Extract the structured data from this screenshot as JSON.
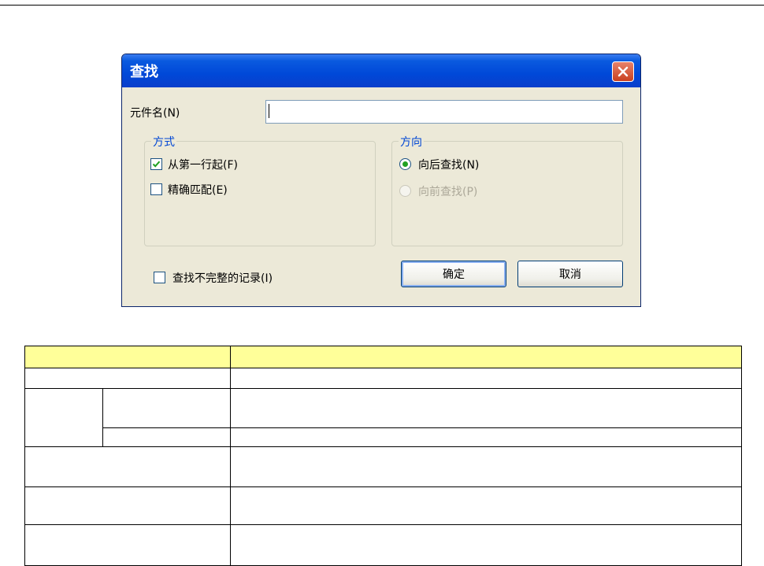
{
  "dialog": {
    "title": "查找",
    "name_label": "元件名(N)",
    "name_value": "",
    "mode_group": {
      "legend": "方式",
      "from_first_row": {
        "label": "从第一行起(F)",
        "checked": true
      },
      "exact_match": {
        "label": "精确匹配(E)",
        "checked": false
      }
    },
    "direction_group": {
      "legend": "方向",
      "backward": {
        "label": "向后查找(N)",
        "selected": true
      },
      "forward": {
        "label": "向前查找(P)",
        "selected": false,
        "disabled": true
      }
    },
    "incomplete_records": {
      "label": "查找不完整的记录(I)",
      "checked": false
    },
    "ok_label": "确定",
    "cancel_label": "取消"
  },
  "colors": {
    "title_bar": "#0a5adf",
    "close_button": "#d9522c",
    "group_legend": "#0046d5",
    "table_header": "#ffff99"
  },
  "icons": [
    "close-icon",
    "check-icon",
    "radio-dot-icon"
  ]
}
